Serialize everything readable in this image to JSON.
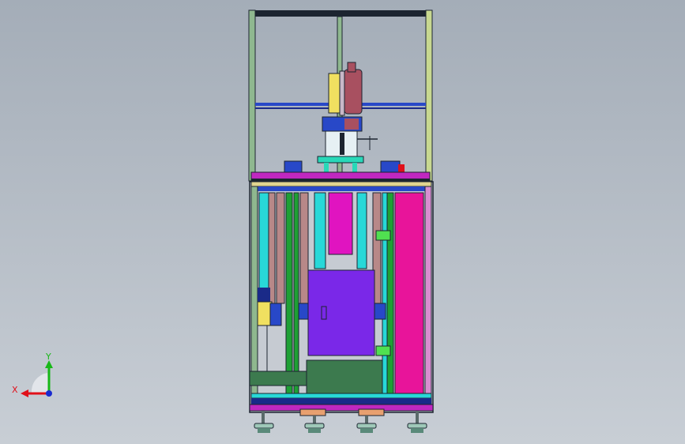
{
  "viewport": {
    "background_top": "#a4adb8",
    "background_bottom": "#c8ced5"
  },
  "triad": {
    "x_label": "X",
    "y_label": "Y",
    "x_color": "#e0101a",
    "y_color": "#18b818",
    "z_color": "#1a2ad0"
  },
  "colors": {
    "frame": "#8fb88f",
    "frame_dark": "#1c2430",
    "magenta": "#e014c0",
    "pink": "#e8149a",
    "violet": "#7a28e8",
    "cyan": "#28d8d8",
    "green": "#1ea034",
    "blue": "#2848c8",
    "navy": "#1a2a88",
    "mauve": "#b88888",
    "olive": "#3c7a4e",
    "yellow": "#f0e060",
    "brown": "#a85060"
  }
}
